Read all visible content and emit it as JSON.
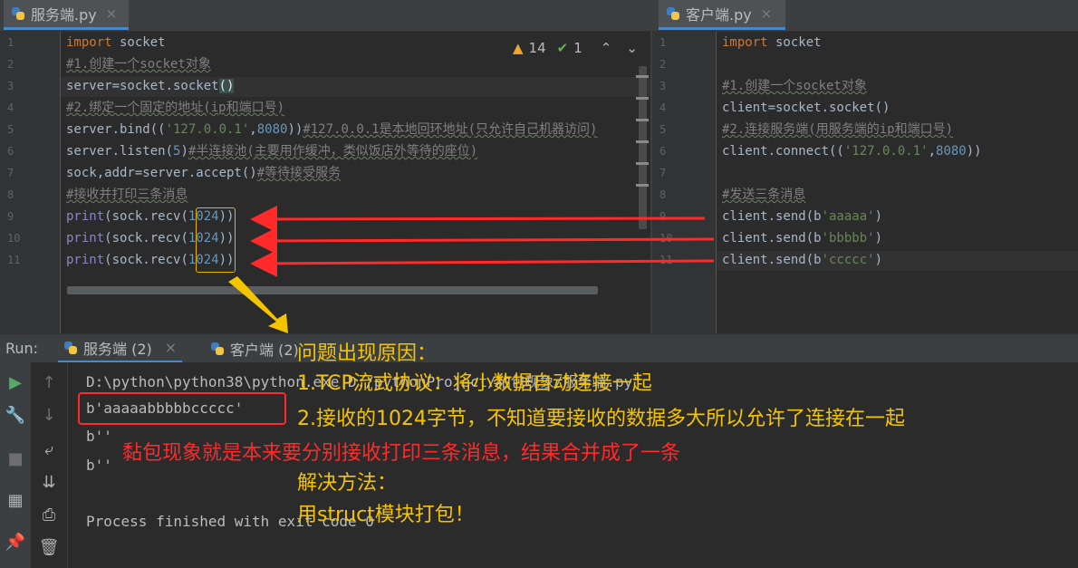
{
  "left_tab": {
    "label": "服务端.py",
    "close": "×"
  },
  "right_tab": {
    "label": "客户端.py",
    "close": "×"
  },
  "inspection": {
    "warnings": "14",
    "ok": "1"
  },
  "left_editor": {
    "line_numbers": [
      "1",
      "2",
      "3",
      "4",
      "5",
      "6",
      "7",
      "8",
      "9",
      "10",
      "11"
    ],
    "lines": [
      {
        "code": [
          {
            "t": "import",
            "c": "kw"
          },
          {
            "t": " socket"
          }
        ]
      },
      {
        "code": [
          {
            "t": "#1.创建一个socket对象",
            "c": "cmt"
          }
        ]
      },
      {
        "code": [
          {
            "t": "server=socket.socket"
          },
          {
            "t": "()",
            "c": "paren"
          }
        ]
      },
      {
        "code": [
          {
            "t": "#2.绑定一个固定的地址(ip和端口号)",
            "c": "cmt"
          }
        ]
      },
      {
        "code": [
          {
            "t": "server.bind(("
          },
          {
            "t": "'127.0.0.1'",
            "c": "str"
          },
          {
            "t": ","
          },
          {
            "t": "8080",
            "c": "num"
          },
          {
            "t": "))"
          },
          {
            "t": "#127.0.0.1是本地回环地址(只允许自己机器访问)",
            "c": "cmt"
          }
        ]
      },
      {
        "code": [
          {
            "t": "server.listen("
          },
          {
            "t": "5",
            "c": "num"
          },
          {
            "t": ")"
          },
          {
            "t": "#半连接池(主要用作缓冲，类似饭店外等待的座位)",
            "c": "cmt"
          }
        ]
      },
      {
        "code": [
          {
            "t": "sock,addr=server.accept()"
          },
          {
            "t": "#等待接受服务",
            "c": "cmt"
          }
        ]
      },
      {
        "code": [
          {
            "t": "#接收并打印三条消息",
            "c": "cmt"
          }
        ]
      },
      {
        "code": [
          {
            "t": "print",
            "c": "fn"
          },
          {
            "t": "(sock.recv("
          },
          {
            "t": "1024",
            "c": "num"
          },
          {
            "t": "))"
          }
        ]
      },
      {
        "code": [
          {
            "t": "print",
            "c": "fn"
          },
          {
            "t": "(sock.recv("
          },
          {
            "t": "1024",
            "c": "num"
          },
          {
            "t": "))"
          }
        ]
      },
      {
        "code": [
          {
            "t": "print",
            "c": "fn"
          },
          {
            "t": "(sock.recv("
          },
          {
            "t": "1024",
            "c": "num"
          },
          {
            "t": "))"
          }
        ]
      }
    ]
  },
  "right_editor": {
    "line_numbers": [
      "1",
      "2",
      "3",
      "4",
      "5",
      "6",
      "7",
      "8",
      "9",
      "10",
      "11"
    ],
    "lines": [
      {
        "code": [
          {
            "t": "import",
            "c": "kw"
          },
          {
            "t": " socket"
          }
        ]
      },
      {
        "code": []
      },
      {
        "code": [
          {
            "t": "#1.创建一个socket对象",
            "c": "cmt"
          }
        ]
      },
      {
        "code": [
          {
            "t": "client=socket.socket()"
          }
        ]
      },
      {
        "code": [
          {
            "t": "#2.连接服务端(用服务端的ip和端口号)",
            "c": "cmt"
          }
        ]
      },
      {
        "code": [
          {
            "t": "client.connect(("
          },
          {
            "t": "'127.0.0.1'",
            "c": "str"
          },
          {
            "t": ","
          },
          {
            "t": "8080",
            "c": "num"
          },
          {
            "t": "))"
          }
        ]
      },
      {
        "code": []
      },
      {
        "code": [
          {
            "t": "#发送三条消息",
            "c": "cmt"
          }
        ]
      },
      {
        "code": [
          {
            "t": "client.send(b"
          },
          {
            "t": "'aaaaa'",
            "c": "str"
          },
          {
            "t": ")"
          }
        ]
      },
      {
        "code": [
          {
            "t": "client.send(b"
          },
          {
            "t": "'bbbbb'",
            "c": "str"
          },
          {
            "t": ")"
          }
        ]
      },
      {
        "code": [
          {
            "t": "client.send(b"
          },
          {
            "t": "'ccccc'",
            "c": "str"
          },
          {
            "t": ")"
          }
        ]
      }
    ]
  },
  "run": {
    "label": "Run:",
    "tabs": [
      {
        "label": "服务端 (2)",
        "close": "×"
      },
      {
        "label": "客户端 (2)"
      }
    ],
    "output": [
      "D:\\python\\python38\\python.exe D:/pythonProject/粘包现象/服务端.py\"",
      "b'aaaaabbbbbccccc'",
      "b''",
      "b''",
      "",
      "Process finished with exit code 0"
    ]
  },
  "annotations": {
    "title": "问题出现原因：",
    "point1": "1.TCP流式协议：将小数据自动连接一起",
    "point2": "2.接收的1024字节，不知道要接收的数据多大所以允许了连接在一起",
    "sticky": "黏包现象就是本来要分别接收打印三条消息，结果合并成了一条",
    "solution_title": "解决方法：",
    "solution": "用struct模块打包！"
  },
  "colors": {
    "annotation_yellow": "#f5c400",
    "annotation_red": "#ff2a2a",
    "highlight_box": "#e8b200"
  }
}
